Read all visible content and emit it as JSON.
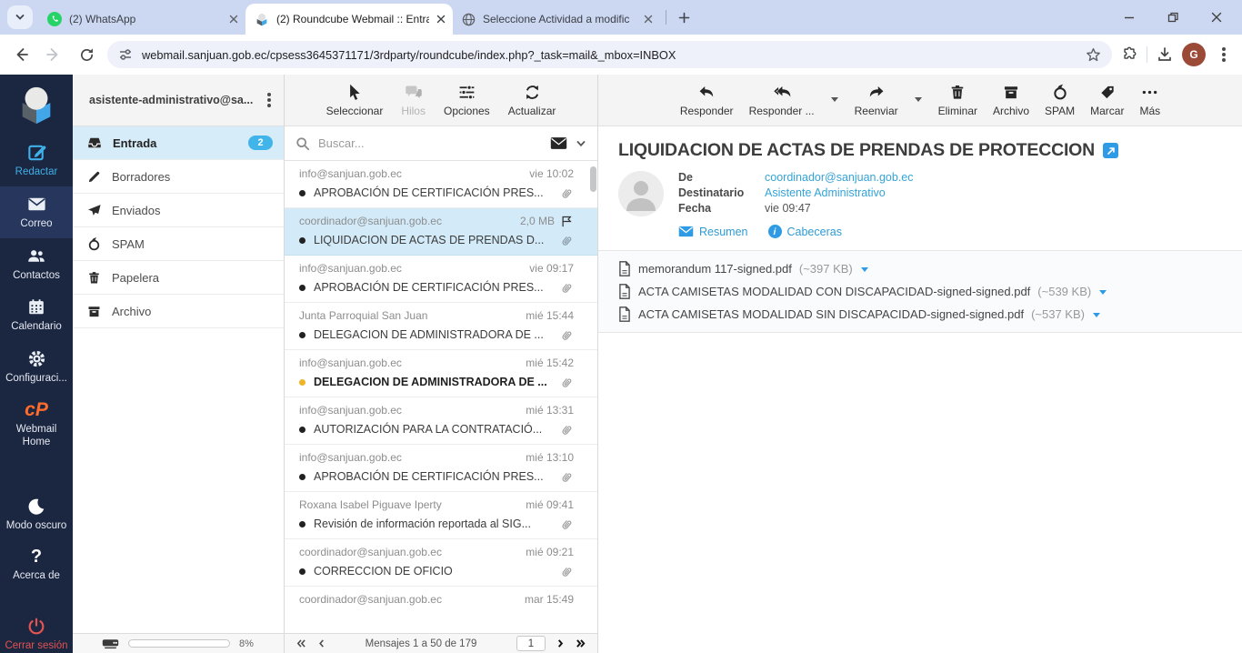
{
  "browser": {
    "tabs": [
      {
        "label": "(2) WhatsApp"
      },
      {
        "label": "(2) Roundcube Webmail :: Entra"
      },
      {
        "label": "Seleccione Actividad a modific"
      }
    ],
    "url": "webmail.sanjuan.gob.ec/cpsess3645371171/3rdparty/roundcube/index.php?_task=mail&_mbox=INBOX",
    "profile_initial": "G"
  },
  "sidebar": {
    "webmail_home_glyph": "cP",
    "acerca_glyph": "?",
    "items": [
      {
        "label": "Redactar"
      },
      {
        "label": "Correo"
      },
      {
        "label": "Contactos"
      },
      {
        "label": "Calendario"
      },
      {
        "label": "Configuraci..."
      },
      {
        "label": "Webmail Home"
      },
      {
        "label": "Modo oscuro"
      },
      {
        "label": "Acerca de"
      },
      {
        "label": "Cerrar sesión"
      }
    ]
  },
  "folders": {
    "account": "asistente-administrativo@sa...",
    "items": [
      {
        "label": "Entrada",
        "count": "2"
      },
      {
        "label": "Borradores"
      },
      {
        "label": "Enviados"
      },
      {
        "label": "SPAM"
      },
      {
        "label": "Papelera"
      },
      {
        "label": "Archivo"
      }
    ],
    "quota_percent": "8%"
  },
  "list": {
    "toolbar": {
      "select": "Seleccionar",
      "threads": "Hilos",
      "options": "Opciones",
      "refresh": "Actualizar"
    },
    "search_placeholder": "Buscar...",
    "messages": [
      {
        "sender": "info@sanjuan.gob.ec",
        "meta": "vie 10:02",
        "subject": "APROBACIÓN DE CERTIFICACIÓN PRES..."
      },
      {
        "sender": "coordinador@sanjuan.gob.ec",
        "meta": "2,0 MB",
        "subject": "LIQUIDACION DE ACTAS DE PRENDAS D..."
      },
      {
        "sender": "info@sanjuan.gob.ec",
        "meta": "vie 09:17",
        "subject": "APROBACIÓN DE CERTIFICACIÓN PRES..."
      },
      {
        "sender": "Junta Parroquial San Juan",
        "meta": "mié 15:44",
        "subject": "DELEGACION DE ADMINISTRADORA DE ..."
      },
      {
        "sender": "info@sanjuan.gob.ec",
        "meta": "mié 15:42",
        "subject": "DELEGACION DE ADMINISTRADORA DE ..."
      },
      {
        "sender": "info@sanjuan.gob.ec",
        "meta": "mié 13:31",
        "subject": "AUTORIZACIÓN PARA LA CONTRATACIÓ..."
      },
      {
        "sender": "info@sanjuan.gob.ec",
        "meta": "mié 13:10",
        "subject": "APROBACIÓN DE CERTIFICACIÓN PRES..."
      },
      {
        "sender": "Roxana Isabel Piguave Iperty",
        "meta": "mié 09:41",
        "subject": "Revisión de información reportada al SIG..."
      },
      {
        "sender": "coordinador@sanjuan.gob.ec",
        "meta": "mié 09:21",
        "subject": "CORRECCION DE OFICIO"
      },
      {
        "sender": "coordinador@sanjuan.gob.ec",
        "meta": "mar 15:49",
        "subject": ""
      }
    ],
    "pagination": {
      "label": "Mensajes 1 a 50 de 179",
      "page": "1"
    }
  },
  "reader": {
    "toolbar": {
      "reply": "Responder",
      "reply_all": "Responder ...",
      "forward": "Reenviar",
      "delete": "Eliminar",
      "archive": "Archivo",
      "spam": "SPAM",
      "mark": "Marcar",
      "more": "Más"
    },
    "subject": "LIQUIDACION DE ACTAS DE PRENDAS DE PROTECCION",
    "headers": {
      "from_label": "De",
      "from": "coordinador@sanjuan.gob.ec",
      "to_label": "Destinatario",
      "to": "Asistente Administrativo",
      "date_label": "Fecha",
      "date": "vie 09:47"
    },
    "summary_label": "Resumen",
    "headers_label": "Cabeceras",
    "attachments": [
      {
        "name": "memorandum 117-signed.pdf",
        "size": "(~397 KB)"
      },
      {
        "name": "ACTA CAMISETAS MODALIDAD CON DISCAPACIDAD-signed-signed.pdf",
        "size": "(~539 KB)"
      },
      {
        "name": "ACTA CAMISETAS MODALIDAD SIN DISCAPACIDAD-signed-signed.pdf",
        "size": "(~537 KB)"
      }
    ]
  }
}
